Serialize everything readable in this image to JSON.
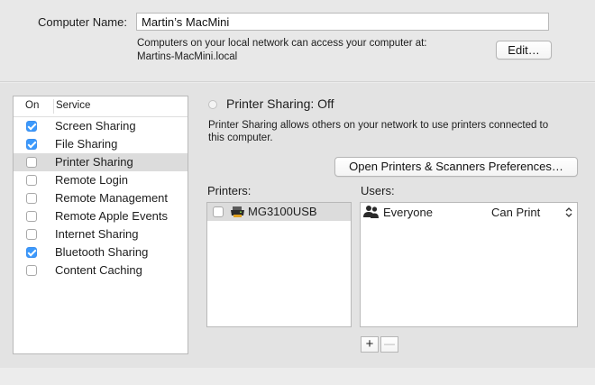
{
  "computer": {
    "name_label": "Computer Name:",
    "name_value": "Martin’s MacMini",
    "network_info": "Computers on your local network can access your computer at:",
    "hostname": "Martins-MacMini.local",
    "edit_button": "Edit…"
  },
  "services": {
    "header_on": "On",
    "header_service": "Service",
    "items": [
      {
        "label": "Screen Sharing",
        "checked": true
      },
      {
        "label": "File Sharing",
        "checked": true
      },
      {
        "label": "Printer Sharing",
        "checked": false,
        "selected": true
      },
      {
        "label": "Remote Login",
        "checked": false
      },
      {
        "label": "Remote Management",
        "checked": false
      },
      {
        "label": "Remote Apple Events",
        "checked": false
      },
      {
        "label": "Internet Sharing",
        "checked": false
      },
      {
        "label": "Bluetooth Sharing",
        "checked": true
      },
      {
        "label": "Content Caching",
        "checked": false
      }
    ]
  },
  "detail": {
    "status": "Printer Sharing: Off",
    "description_line1": "Printer Sharing allows others on your network to use printers connected to",
    "description_line2": "this computer.",
    "open_prefs_button": "Open Printers & Scanners Preferences…",
    "printers_label": "Printers:",
    "users_label": "Users:",
    "printers": [
      {
        "name": "MG3100USB",
        "checked": false
      }
    ],
    "users": [
      {
        "name": "Everyone",
        "permission": "Can Print"
      }
    ],
    "add_button": "+",
    "remove_button": "—"
  },
  "colors": {
    "checkbox_accent": "#3b99fc",
    "selection_gray": "#dcdcdc"
  }
}
